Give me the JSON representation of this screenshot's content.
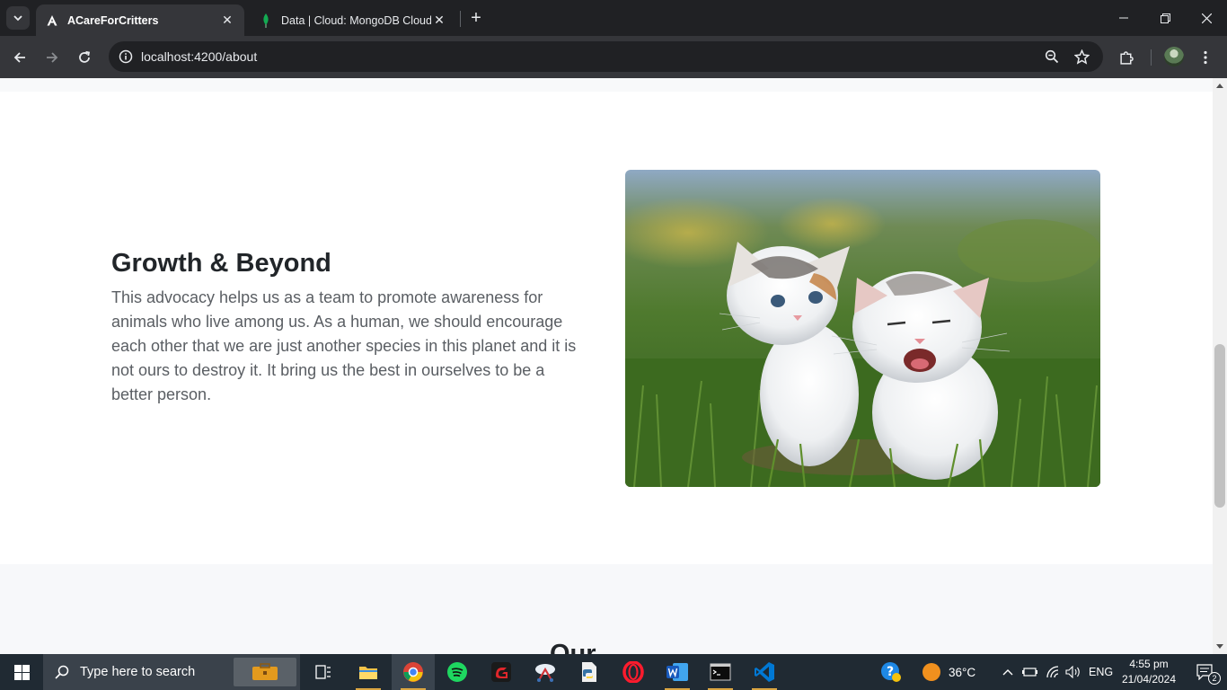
{
  "browser": {
    "tabs": [
      {
        "title": "ACareForCritters",
        "active": true
      },
      {
        "title": "Data | Cloud: MongoDB Cloud",
        "active": false
      }
    ],
    "url": "localhost:4200/about"
  },
  "page": {
    "heading": "Growth & Beyond",
    "paragraph": "This advocacy helps us as a team to promote awareness for animals who live among us. As a human, we should encourage each other that we are just another species in this planet and it is not ours to destroy it. It bring us the best in ourselves to be a better person.",
    "image_subject": "two kittens in grass",
    "next_section_heading": "Our team"
  },
  "taskbar": {
    "search_placeholder": "Type here to search",
    "temperature": "36°C",
    "language": "ENG",
    "time": "4:55 pm",
    "date": "21/04/2024",
    "notification_count": "2"
  },
  "colors": {
    "accent_active_underline": "#d9a441",
    "tab_strip": "#202124",
    "toolbar": "#35363a"
  }
}
